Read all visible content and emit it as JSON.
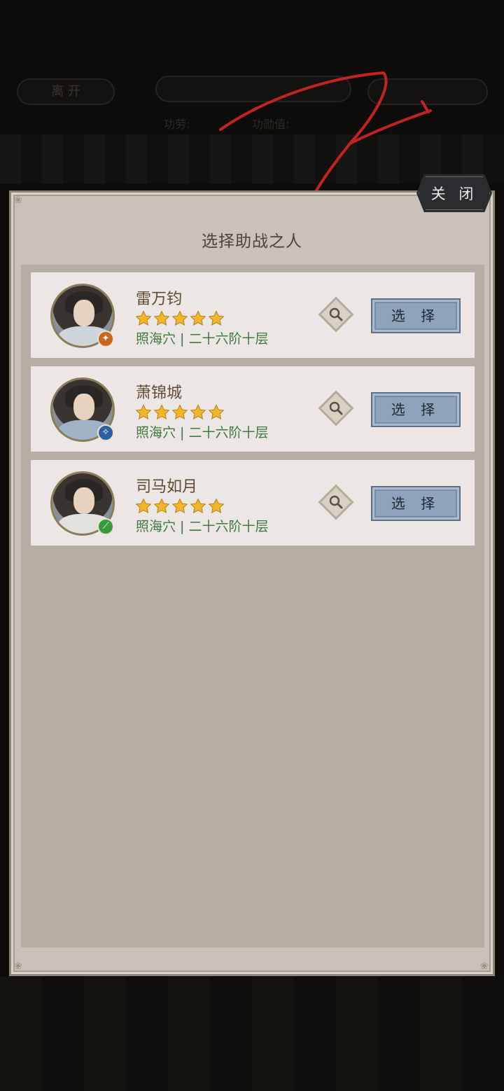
{
  "background": {
    "leave_label": "离 开",
    "merit_label": "功劳:",
    "merit_value_label": "功勋值:"
  },
  "dialog": {
    "title": "选择助战之人",
    "close_label": "关 闭"
  },
  "heroes": [
    {
      "name": "雷万钧",
      "stars": 5,
      "realm": "照海穴 | 二十六阶十层",
      "select_label": "选 择",
      "badge_color": "#c9651f"
    },
    {
      "name": "萧锦城",
      "stars": 5,
      "realm": "照海穴 | 二十六阶十层",
      "select_label": "选 择",
      "badge_color": "#2e5f9e"
    },
    {
      "name": "司马如月",
      "stars": 5,
      "realm": "照海穴 | 二十六阶十层",
      "select_label": "选 择",
      "badge_color": "#3a9a3a"
    }
  ],
  "colors": {
    "realm_text": "#3d7a3a",
    "select_button": "#8ea3bd",
    "star": "#f2b62c",
    "scribble": "#c4241f"
  }
}
